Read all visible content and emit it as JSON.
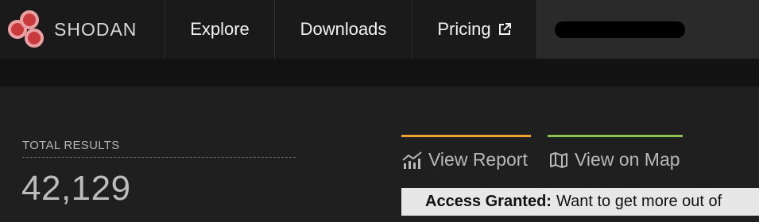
{
  "brand": {
    "name": "SHODAN",
    "logo_icon": "shodan-logo-icon",
    "logo_color": "#c93a3d"
  },
  "nav": {
    "explore": "Explore",
    "downloads": "Downloads",
    "pricing": "Pricing",
    "pricing_icon": "external-link-icon"
  },
  "summary": {
    "total_label": "TOTAL RESULTS",
    "total_value": "42,129"
  },
  "tabs": {
    "report": {
      "label": "View Report",
      "icon": "chart-icon",
      "accent": "#f0a02e"
    },
    "map": {
      "label": "View on Map",
      "icon": "map-icon",
      "accent": "#8cc050"
    }
  },
  "banner": {
    "strong": "Access Granted:",
    "text": "Want to get more out of"
  }
}
